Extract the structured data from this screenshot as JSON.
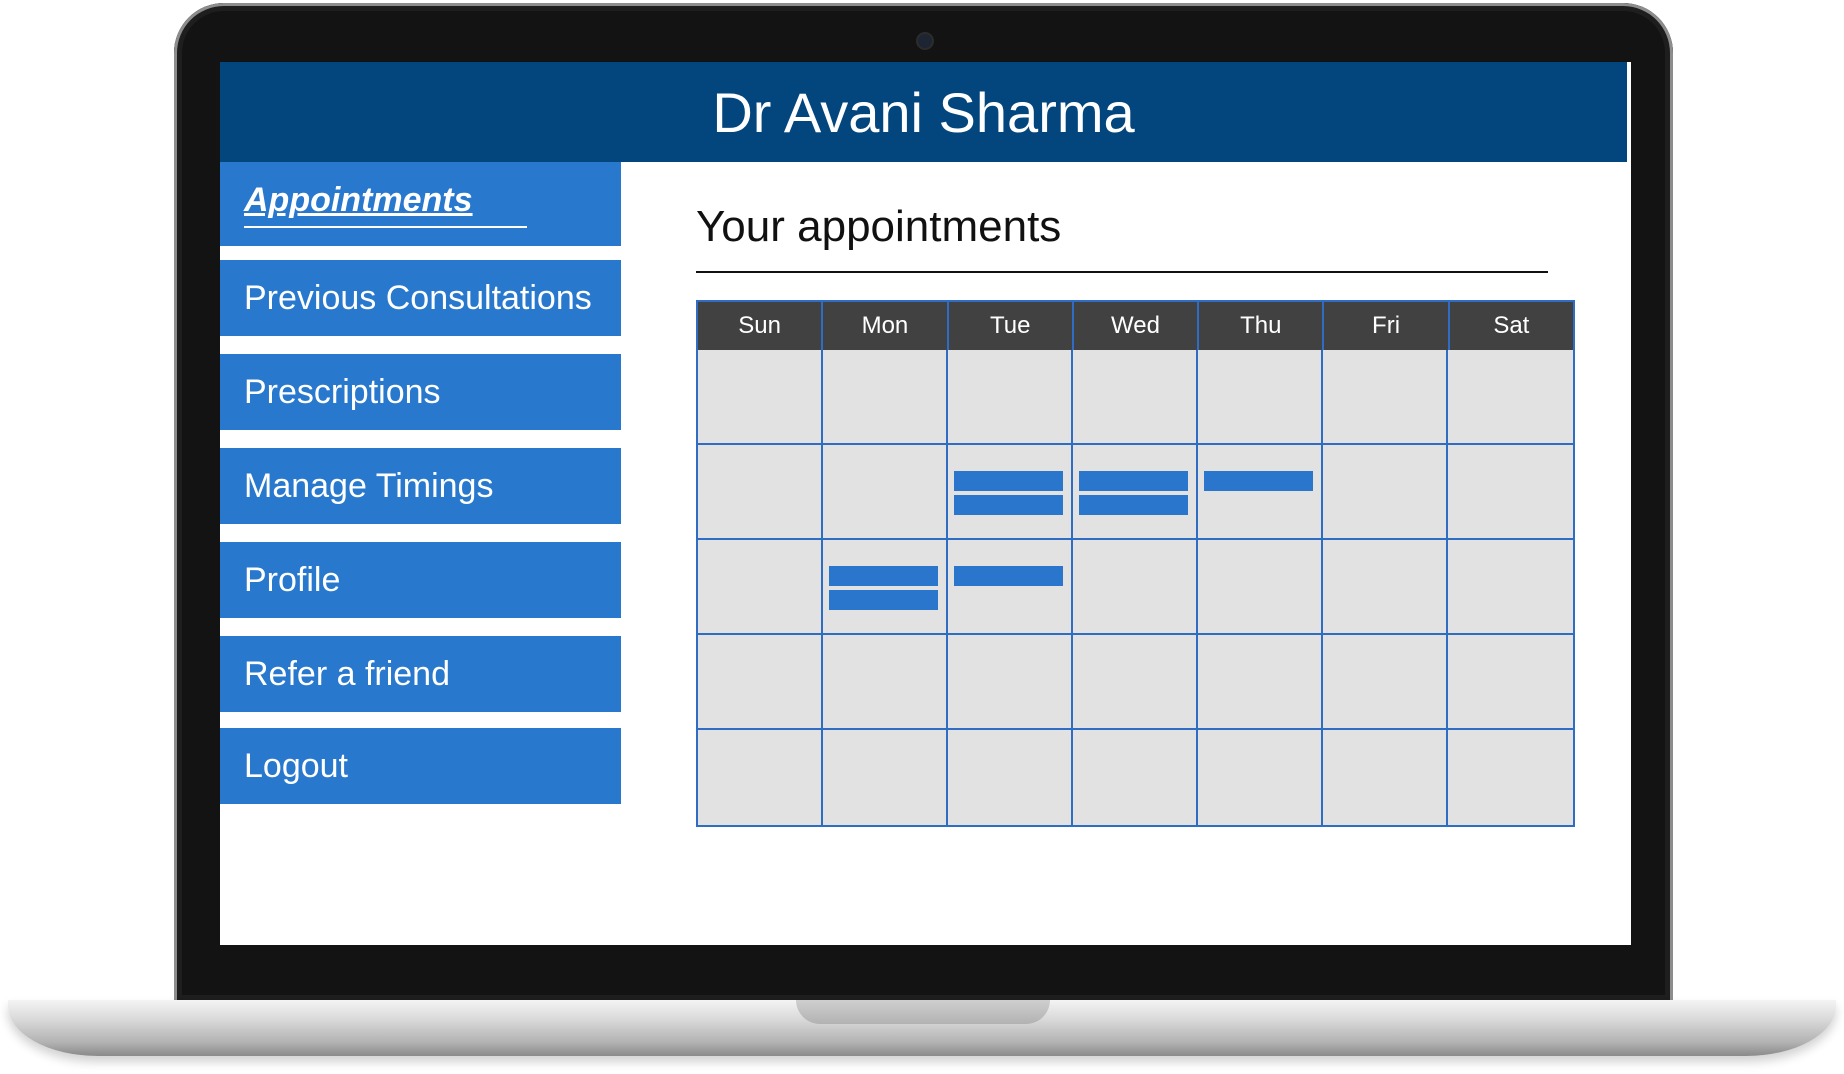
{
  "header": {
    "title": "Dr Avani Sharma"
  },
  "sidebar": {
    "items": [
      {
        "label": "Appointments",
        "active": true
      },
      {
        "label": "Previous Consultations"
      },
      {
        "label": "Prescriptions"
      },
      {
        "label": "Manage Timings"
      },
      {
        "label": "Profile"
      },
      {
        "label": "Refer a friend"
      },
      {
        "label": "Logout"
      }
    ]
  },
  "main": {
    "title": "Your appointments",
    "calendar": {
      "days": [
        "Sun",
        "Mon",
        "Tue",
        "Wed",
        "Thu",
        "Fri",
        "Sat"
      ],
      "rows": 5,
      "events": [
        {
          "row": 1,
          "day": "Tue",
          "count": 2
        },
        {
          "row": 1,
          "day": "Wed",
          "count": 2
        },
        {
          "row": 1,
          "day": "Thu",
          "count": 1
        },
        {
          "row": 2,
          "day": "Mon",
          "count": 2
        },
        {
          "row": 2,
          "day": "Tue",
          "count": 1
        }
      ]
    }
  },
  "colors": {
    "header_bg": "#03467d",
    "nav_bg": "#2878ce",
    "event_bar": "#2a76cc",
    "grid_line": "#2f6cc4",
    "calendar_header_bg": "#414141",
    "cell_bg": "#e2e2e2"
  }
}
